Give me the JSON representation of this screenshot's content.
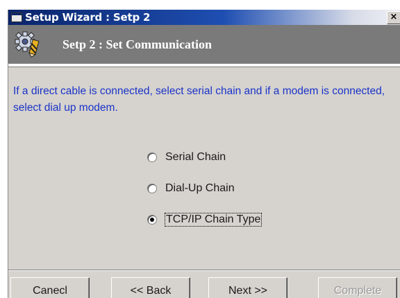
{
  "window": {
    "title": "Setup Wizard : Setp 2",
    "close_glyph": "×"
  },
  "header": {
    "title": "Setp 2 : Set Communication",
    "icon": "gear-pencil-icon"
  },
  "instructions": "If a direct cable is connected, select serial chain and if a modem is connected, select dial up modem.",
  "options": [
    {
      "label": "Serial Chain",
      "checked": false
    },
    {
      "label": "Dial-Up Chain",
      "checked": false
    },
    {
      "label": "TCP/IP Chain Type",
      "checked": true
    }
  ],
  "buttons": {
    "cancel": "Canecl",
    "back": "<< Back",
    "next": "Next >>",
    "complete": "Complete"
  },
  "colors": {
    "instruction_text": "#1a33c8",
    "header_band": "#7a7a7a",
    "title_bar": "#0a246a"
  }
}
